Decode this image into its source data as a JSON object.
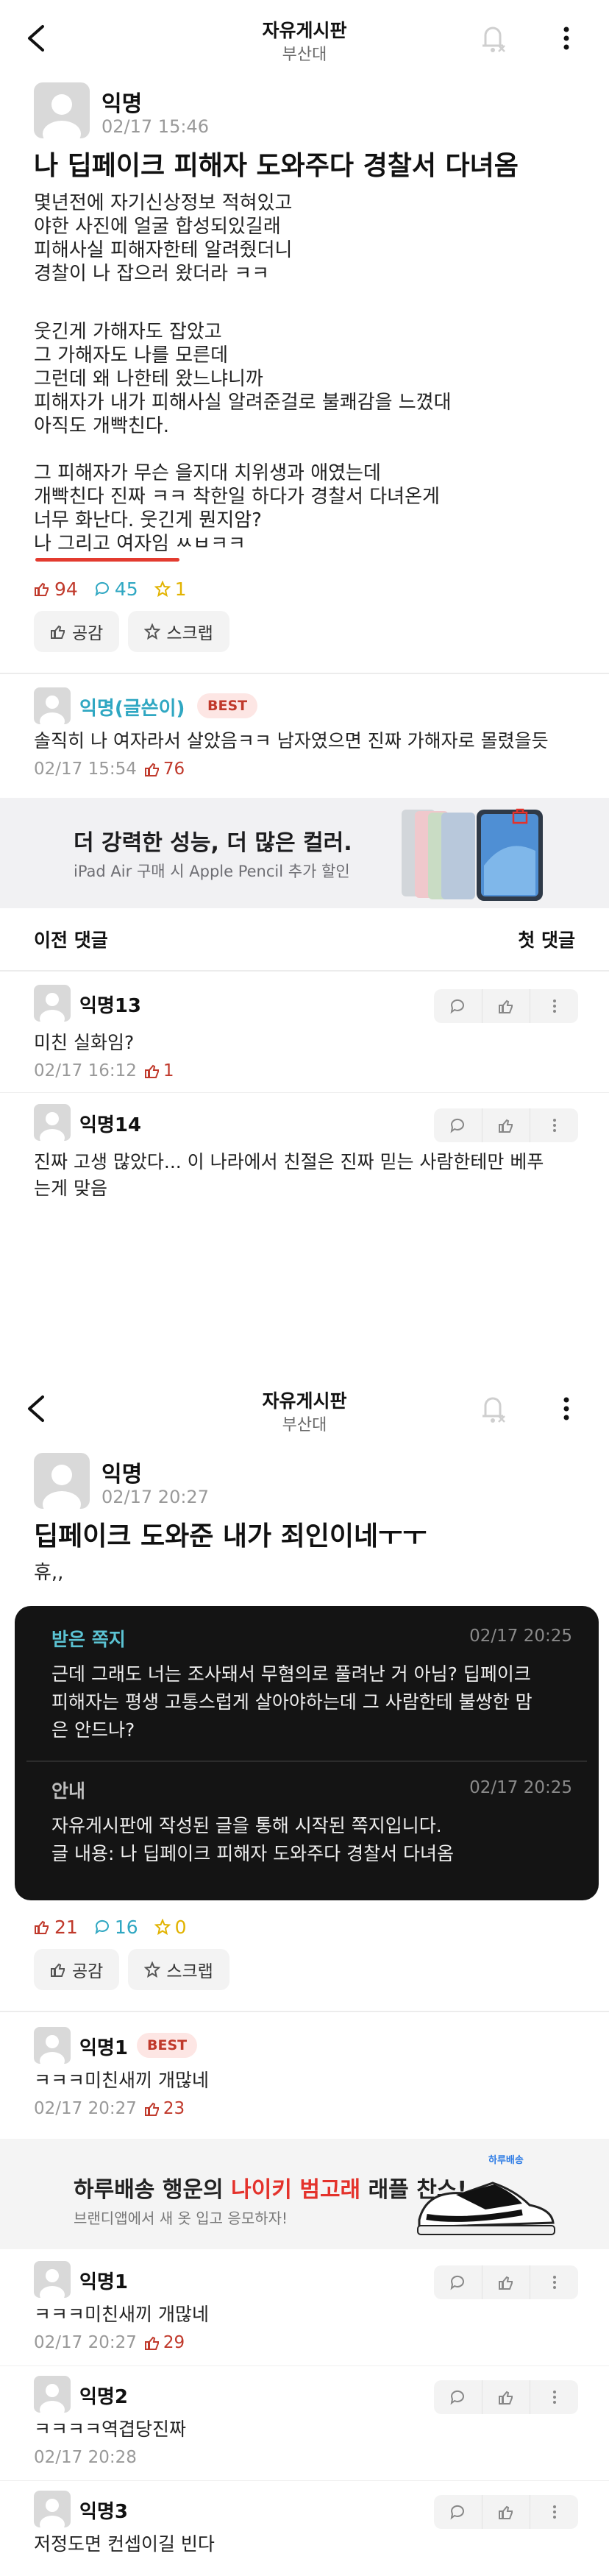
{
  "screen1": {
    "header": {
      "title": "자유게시판",
      "subtitle": "부산대"
    },
    "post": {
      "author": "익명",
      "time": "02/17 15:46",
      "title": "나 딥페이크 피해자 도와주다 경찰서 다녀옴",
      "body": [
        "몇년전에 자기신상정보 적혀있고",
        "야한 사진에 얼굴 합성되있길래",
        "피해사실 피해자한테 알려줬더니",
        "경찰이 나 잡으러 왔더라 ㅋㅋ",
        "",
        "웃긴게 가해자도 잡았고",
        "그 가해자도 나를 모른데",
        "그런데 왜 나한테 왔느냐니까",
        "피해자가 내가 피해사실 알려준걸로 불쾌감을 느꼈대",
        "아직도 개빡친다.",
        "",
        "그 피해자가 무슨 을지대 치위생과 애였는데",
        "개빡친다 진짜 ㅋㅋ 착한일 하다가 경찰서 다녀온게",
        "너무 화난다. 웃긴게 뭔지암?",
        "나 그리고 여자임 ㅆㅂㅋㅋ"
      ],
      "likes": "94",
      "comments": "45",
      "scraps": "1",
      "like_button": "공감",
      "scrap_button": "스크랩"
    },
    "best_comment": {
      "author": "익명(글쓴이)",
      "badge": "BEST",
      "text": "솔직히 나 여자라서 살았음ㅋㅋ 남자였으면 진짜 가해자로 몰렸을듯",
      "time": "02/17 15:54",
      "likes": "76"
    },
    "ad": {
      "headline": "더 강력한 성능, 더 많은 컬러.",
      "sub": "iPad Air 구매 시 Apple Pencil 추가 할인"
    },
    "nav": {
      "prev": "이전 댓글",
      "first": "첫 댓글"
    },
    "comments": [
      {
        "author": "익명13",
        "text": [
          "미친 실화임?"
        ],
        "time": "02/17 16:12",
        "likes": "1"
      },
      {
        "author": "익명14",
        "text": [
          "진짜 고생 많았다... 이 나라에서 친절은 진짜 믿는 사람한테만 베푸",
          "는게 맞음"
        ]
      }
    ]
  },
  "screen2": {
    "header": {
      "title": "자유게시판",
      "subtitle": "부산대"
    },
    "post": {
      "author": "익명",
      "time": "02/17 20:27",
      "title": "딥페이크 도와준 내가 죄인이네ㅜㅜ",
      "body": [
        "휴,,"
      ],
      "likes": "21",
      "comments": "16",
      "scraps": "0",
      "like_button": "공감",
      "scrap_button": "스크랩"
    },
    "message": {
      "received_label": "받은 쪽지",
      "received_time": "02/17 20:25",
      "received_text": [
        "근데 그래도 너는 조사돼서 무혐의로 풀려난 거 아님? 딥페이크",
        "피해자는 평생 고통스럽게 살아야하는데 그 사람한테 불쌍한 맘",
        "은 안드나?"
      ],
      "notice_label": "안내",
      "notice_time": "02/17 20:25",
      "notice_text": [
        "자유게시판에 작성된 글을 통해 시작된 쪽지입니다.",
        "글 내용: 나 딥페이크 피해자 도와주다 경찰서 다녀옴"
      ]
    },
    "best_comment": {
      "author": "익명1",
      "badge": "BEST",
      "text": "ㅋㅋㅋ미친새끼 개많네",
      "time": "02/17 20:27",
      "likes": "23"
    },
    "ad": {
      "headline_pre": "하루배송 행운의 ",
      "headline_hl": "나이키 범고래",
      "headline_post": " 래플 찬스!",
      "sub": "브랜디앱에서 새 옷 입고 응모하자!",
      "brand": "하루배송"
    },
    "comments": [
      {
        "author": "익명1",
        "text": "ㅋㅋㅋ미친새끼 개많네",
        "time": "02/17 20:27",
        "likes": "29"
      },
      {
        "author": "익명2",
        "text": "ㅋㅋㅋㅋ역겹당진짜",
        "time": "02/17 20:28"
      },
      {
        "author": "익명3",
        "text": "저정도면 컨셉이길 빈다"
      }
    ]
  },
  "colors": {
    "like": "#c0392b",
    "comment": "#2fa7c2",
    "scrap": "#e2b300",
    "best_bg": "#fde6e4",
    "underline": "#e33b2f"
  }
}
